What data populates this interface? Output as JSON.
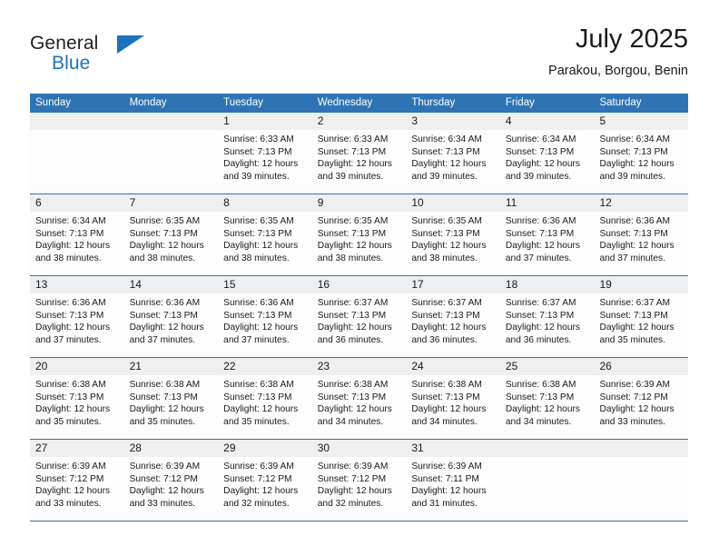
{
  "brand": {
    "name_part1": "General",
    "name_part2": "Blue",
    "triangle_color": "#1e72bb"
  },
  "header": {
    "title": "July 2025",
    "subtitle": "Parakou, Borgou, Benin"
  },
  "colors": {
    "header_blue": "#2e74b5",
    "day_band_gray": "#efefef",
    "text": "#1a1a1a"
  },
  "weekdays": [
    "Sunday",
    "Monday",
    "Tuesday",
    "Wednesday",
    "Thursday",
    "Friday",
    "Saturday"
  ],
  "weeks": [
    [
      {
        "day": "",
        "sunrise": "",
        "sunset": "",
        "daylight": ""
      },
      {
        "day": "",
        "sunrise": "",
        "sunset": "",
        "daylight": ""
      },
      {
        "day": "1",
        "sunrise": "Sunrise: 6:33 AM",
        "sunset": "Sunset: 7:13 PM",
        "daylight": "Daylight: 12 hours and 39 minutes."
      },
      {
        "day": "2",
        "sunrise": "Sunrise: 6:33 AM",
        "sunset": "Sunset: 7:13 PM",
        "daylight": "Daylight: 12 hours and 39 minutes."
      },
      {
        "day": "3",
        "sunrise": "Sunrise: 6:34 AM",
        "sunset": "Sunset: 7:13 PM",
        "daylight": "Daylight: 12 hours and 39 minutes."
      },
      {
        "day": "4",
        "sunrise": "Sunrise: 6:34 AM",
        "sunset": "Sunset: 7:13 PM",
        "daylight": "Daylight: 12 hours and 39 minutes."
      },
      {
        "day": "5",
        "sunrise": "Sunrise: 6:34 AM",
        "sunset": "Sunset: 7:13 PM",
        "daylight": "Daylight: 12 hours and 39 minutes."
      }
    ],
    [
      {
        "day": "6",
        "sunrise": "Sunrise: 6:34 AM",
        "sunset": "Sunset: 7:13 PM",
        "daylight": "Daylight: 12 hours and 38 minutes."
      },
      {
        "day": "7",
        "sunrise": "Sunrise: 6:35 AM",
        "sunset": "Sunset: 7:13 PM",
        "daylight": "Daylight: 12 hours and 38 minutes."
      },
      {
        "day": "8",
        "sunrise": "Sunrise: 6:35 AM",
        "sunset": "Sunset: 7:13 PM",
        "daylight": "Daylight: 12 hours and 38 minutes."
      },
      {
        "day": "9",
        "sunrise": "Sunrise: 6:35 AM",
        "sunset": "Sunset: 7:13 PM",
        "daylight": "Daylight: 12 hours and 38 minutes."
      },
      {
        "day": "10",
        "sunrise": "Sunrise: 6:35 AM",
        "sunset": "Sunset: 7:13 PM",
        "daylight": "Daylight: 12 hours and 38 minutes."
      },
      {
        "day": "11",
        "sunrise": "Sunrise: 6:36 AM",
        "sunset": "Sunset: 7:13 PM",
        "daylight": "Daylight: 12 hours and 37 minutes."
      },
      {
        "day": "12",
        "sunrise": "Sunrise: 6:36 AM",
        "sunset": "Sunset: 7:13 PM",
        "daylight": "Daylight: 12 hours and 37 minutes."
      }
    ],
    [
      {
        "day": "13",
        "sunrise": "Sunrise: 6:36 AM",
        "sunset": "Sunset: 7:13 PM",
        "daylight": "Daylight: 12 hours and 37 minutes."
      },
      {
        "day": "14",
        "sunrise": "Sunrise: 6:36 AM",
        "sunset": "Sunset: 7:13 PM",
        "daylight": "Daylight: 12 hours and 37 minutes."
      },
      {
        "day": "15",
        "sunrise": "Sunrise: 6:36 AM",
        "sunset": "Sunset: 7:13 PM",
        "daylight": "Daylight: 12 hours and 37 minutes."
      },
      {
        "day": "16",
        "sunrise": "Sunrise: 6:37 AM",
        "sunset": "Sunset: 7:13 PM",
        "daylight": "Daylight: 12 hours and 36 minutes."
      },
      {
        "day": "17",
        "sunrise": "Sunrise: 6:37 AM",
        "sunset": "Sunset: 7:13 PM",
        "daylight": "Daylight: 12 hours and 36 minutes."
      },
      {
        "day": "18",
        "sunrise": "Sunrise: 6:37 AM",
        "sunset": "Sunset: 7:13 PM",
        "daylight": "Daylight: 12 hours and 36 minutes."
      },
      {
        "day": "19",
        "sunrise": "Sunrise: 6:37 AM",
        "sunset": "Sunset: 7:13 PM",
        "daylight": "Daylight: 12 hours and 35 minutes."
      }
    ],
    [
      {
        "day": "20",
        "sunrise": "Sunrise: 6:38 AM",
        "sunset": "Sunset: 7:13 PM",
        "daylight": "Daylight: 12 hours and 35 minutes."
      },
      {
        "day": "21",
        "sunrise": "Sunrise: 6:38 AM",
        "sunset": "Sunset: 7:13 PM",
        "daylight": "Daylight: 12 hours and 35 minutes."
      },
      {
        "day": "22",
        "sunrise": "Sunrise: 6:38 AM",
        "sunset": "Sunset: 7:13 PM",
        "daylight": "Daylight: 12 hours and 35 minutes."
      },
      {
        "day": "23",
        "sunrise": "Sunrise: 6:38 AM",
        "sunset": "Sunset: 7:13 PM",
        "daylight": "Daylight: 12 hours and 34 minutes."
      },
      {
        "day": "24",
        "sunrise": "Sunrise: 6:38 AM",
        "sunset": "Sunset: 7:13 PM",
        "daylight": "Daylight: 12 hours and 34 minutes."
      },
      {
        "day": "25",
        "sunrise": "Sunrise: 6:38 AM",
        "sunset": "Sunset: 7:13 PM",
        "daylight": "Daylight: 12 hours and 34 minutes."
      },
      {
        "day": "26",
        "sunrise": "Sunrise: 6:39 AM",
        "sunset": "Sunset: 7:12 PM",
        "daylight": "Daylight: 12 hours and 33 minutes."
      }
    ],
    [
      {
        "day": "27",
        "sunrise": "Sunrise: 6:39 AM",
        "sunset": "Sunset: 7:12 PM",
        "daylight": "Daylight: 12 hours and 33 minutes."
      },
      {
        "day": "28",
        "sunrise": "Sunrise: 6:39 AM",
        "sunset": "Sunset: 7:12 PM",
        "daylight": "Daylight: 12 hours and 33 minutes."
      },
      {
        "day": "29",
        "sunrise": "Sunrise: 6:39 AM",
        "sunset": "Sunset: 7:12 PM",
        "daylight": "Daylight: 12 hours and 32 minutes."
      },
      {
        "day": "30",
        "sunrise": "Sunrise: 6:39 AM",
        "sunset": "Sunset: 7:12 PM",
        "daylight": "Daylight: 12 hours and 32 minutes."
      },
      {
        "day": "31",
        "sunrise": "Sunrise: 6:39 AM",
        "sunset": "Sunset: 7:11 PM",
        "daylight": "Daylight: 12 hours and 31 minutes."
      },
      {
        "day": "",
        "sunrise": "",
        "sunset": "",
        "daylight": ""
      },
      {
        "day": "",
        "sunrise": "",
        "sunset": "",
        "daylight": ""
      }
    ]
  ]
}
